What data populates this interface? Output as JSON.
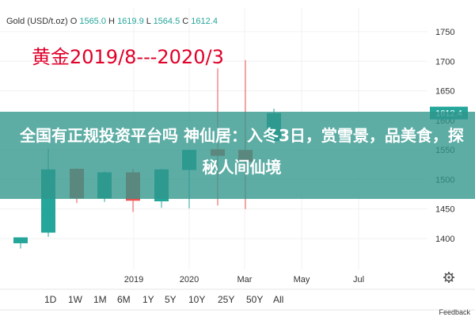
{
  "header": {
    "symbol": "Gold (USD/t.oz)",
    "o_label": "O",
    "o_value": "1565.0",
    "h_label": "H",
    "h_value": "1619.9",
    "l_label": "L",
    "l_value": "1564.5",
    "c_label": "C",
    "c_value": "1612.4"
  },
  "overlay_title": "黄金2019/8---2020/3",
  "banner_text": "全国有正规投资平台吗 神仙居：入冬3日，赏雪景，品美食，探秘人间仙境",
  "range_buttons": [
    "1D",
    "1W",
    "1M",
    "6M",
    "1Y",
    "5Y",
    "10Y",
    "25Y",
    "50Y",
    "All"
  ],
  "feedback": "Feedback",
  "colors": {
    "up": "#26a69a",
    "down": "#ef5350",
    "doji": "#ef5350"
  },
  "chart_data": {
    "type": "candlestick",
    "y_ticks": [
      1400,
      1450,
      1500,
      1550,
      1600,
      1650,
      1700,
      1750
    ],
    "ylim": [
      1360,
      1790
    ],
    "last_price": "1612.4",
    "x_tick_labels": [
      "2019",
      "2020",
      "Mar",
      "May",
      "Jul"
    ],
    "candles": [
      {
        "o": 1392,
        "h": 1402,
        "l": 1383,
        "c": 1402
      },
      {
        "o": 1410,
        "h": 1552,
        "l": 1403,
        "c": 1517
      },
      {
        "o": 1518,
        "h": 1520,
        "l": 1460,
        "c": 1468
      },
      {
        "o": 1468,
        "h": 1513,
        "l": 1462,
        "c": 1512
      },
      {
        "o": 1512,
        "h": 1518,
        "l": 1445,
        "c": 1464
      },
      {
        "o": 1463,
        "h": 1518,
        "l": 1452,
        "c": 1517
      },
      {
        "o": 1516,
        "h": 1550,
        "l": 1451,
        "c": 1550
      },
      {
        "o": 1551,
        "h": 1688,
        "l": 1456,
        "c": 1540
      },
      {
        "o": 1550,
        "h": 1702,
        "l": 1450,
        "c": 1530
      },
      {
        "o": 1565.0,
        "h": 1619.9,
        "l": 1564.5,
        "c": 1612.4
      }
    ]
  }
}
